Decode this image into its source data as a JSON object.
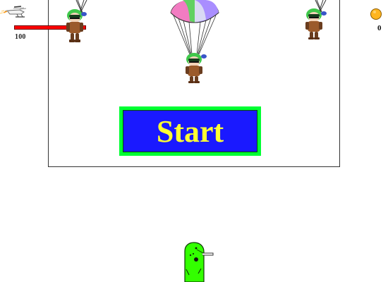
{
  "hud": {
    "health_value": "100",
    "coin_count": "0",
    "helicopter_icon": "helicopter-icon",
    "coin_icon": "coin-icon"
  },
  "screen": {
    "start_label": "Start",
    "start_border_color": "#00ff33",
    "start_fill_color": "#1a19ff",
    "start_text_color": "#ffff33"
  },
  "health": {
    "fraction": 1.0,
    "bar_color": "#ff0000"
  },
  "sprites": {
    "paratrooper_icon": "paratrooper-icon",
    "parachute_icon": "parachute-icon",
    "player_icon": "player-cannon-icon",
    "player_color": "#33ff00"
  }
}
